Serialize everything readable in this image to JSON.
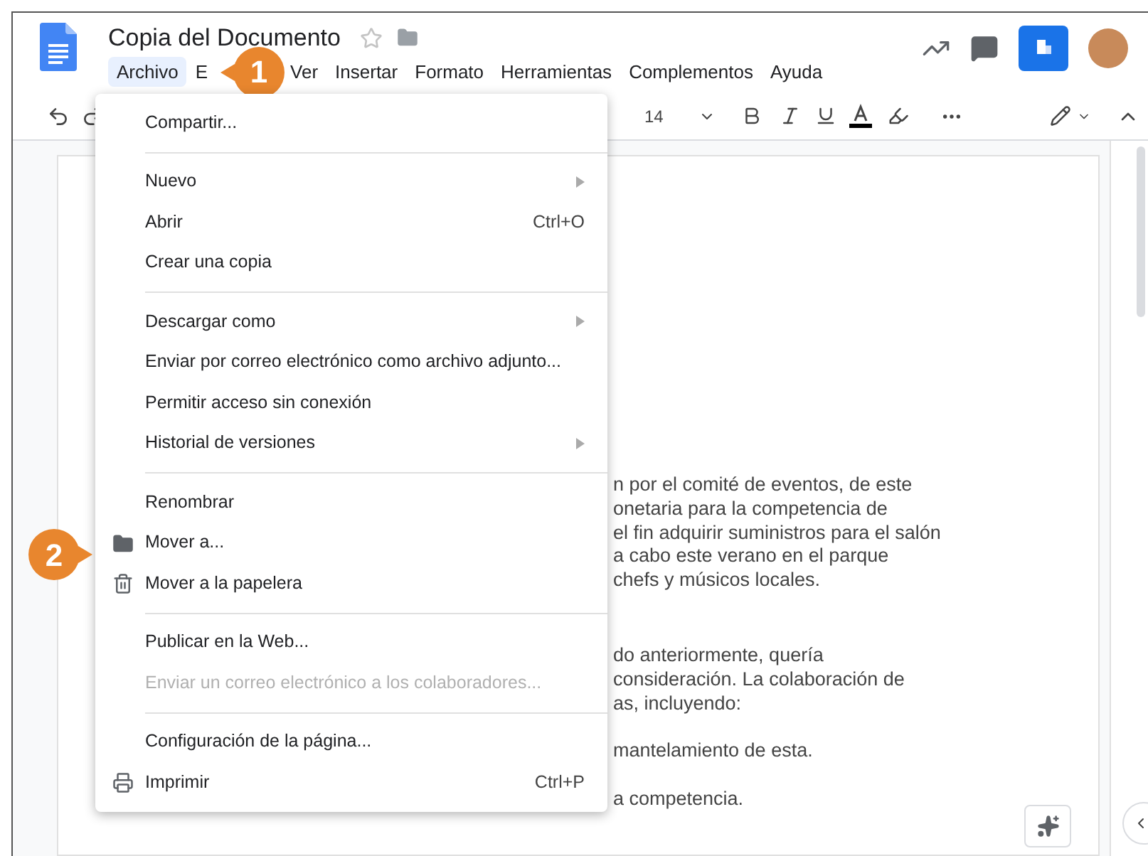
{
  "document": {
    "title": "Copia del Documento"
  },
  "menubar": [
    {
      "label": "Archivo",
      "selected": true
    },
    {
      "label": "E",
      "selected": false
    },
    {
      "label": "Ver",
      "selected": false
    },
    {
      "label": "Insertar",
      "selected": false
    },
    {
      "label": "Formato",
      "selected": false
    },
    {
      "label": "Herramientas",
      "selected": false
    },
    {
      "label": "Complementos",
      "selected": false
    },
    {
      "label": "Ayuda",
      "selected": false
    }
  ],
  "callouts": [
    {
      "number": "1"
    },
    {
      "number": "2"
    }
  ],
  "toolbar": {
    "font_size": "14"
  },
  "file_menu": [
    [
      {
        "label": "Compartir...",
        "kind": "plain",
        "submenu": false,
        "disabled": false
      }
    ],
    [
      {
        "label": "Nuevo",
        "kind": "plain",
        "submenu": true,
        "disabled": false
      },
      {
        "label": "Abrir",
        "kind": "plain",
        "shortcut": "Ctrl+O",
        "submenu": false,
        "disabled": false
      },
      {
        "label": "Crear una copia",
        "kind": "plain",
        "submenu": false,
        "disabled": false
      }
    ],
    [
      {
        "label": "Descargar como",
        "kind": "plain",
        "submenu": true,
        "disabled": false
      },
      {
        "label": "Enviar por correo electrónico como archivo adjunto...",
        "kind": "plain",
        "submenu": false,
        "disabled": false
      },
      {
        "label": "Permitir acceso sin conexión",
        "kind": "plain",
        "submenu": false,
        "disabled": false
      },
      {
        "label": "Historial de versiones",
        "kind": "plain",
        "submenu": true,
        "disabled": false
      }
    ],
    [
      {
        "label": "Renombrar",
        "kind": "plain",
        "submenu": false,
        "disabled": false
      },
      {
        "label": "Mover a...",
        "kind": "move",
        "submenu": false,
        "disabled": false
      },
      {
        "label": "Mover a la papelera",
        "kind": "delete",
        "submenu": false,
        "disabled": false
      }
    ],
    [
      {
        "label": "Publicar en la Web...",
        "kind": "plain",
        "submenu": false,
        "disabled": false
      },
      {
        "label": "Enviar un correo electrónico a los colaboradores...",
        "kind": "plain",
        "submenu": false,
        "disabled": true
      }
    ],
    [
      {
        "label": "Configuración de la página...",
        "kind": "plain",
        "submenu": false,
        "disabled": false
      },
      {
        "label": "Imprimir",
        "kind": "print",
        "shortcut": "Ctrl+P",
        "submenu": false,
        "disabled": false
      }
    ]
  ],
  "body_paragraphs": [
    [
      "n por el comité de eventos, de este",
      "onetaria para la competencia de",
      "el fin adquirir suministros para el salón",
      "a cabo este verano en el parque",
      "chefs y músicos locales."
    ],
    [
      "do anteriormente, quería",
      "consideración. La colaboración de",
      "as, incluyendo:"
    ],
    [
      "mantelamiento de esta."
    ],
    [
      "a competencia."
    ]
  ]
}
